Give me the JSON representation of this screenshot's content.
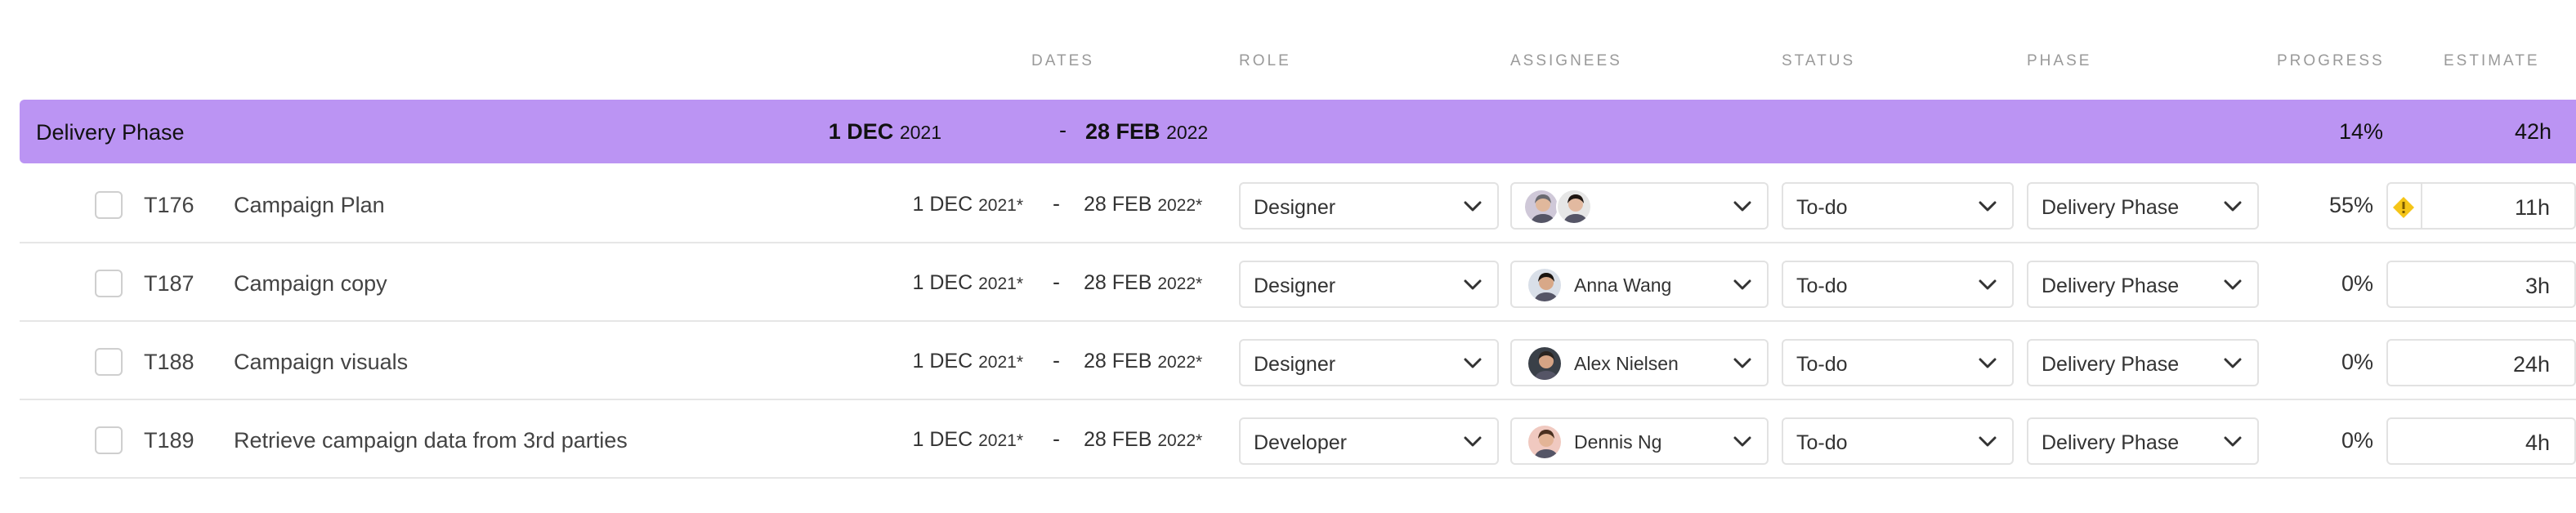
{
  "headers": {
    "dates": "DATES",
    "role": "ROLE",
    "assignees": "ASSIGNEES",
    "status": "STATUS",
    "phase": "PHASE",
    "progress": "PROGRESS",
    "estimate": "ESTIMATE"
  },
  "group": {
    "name": "Delivery Phase",
    "start_day": "1 DEC",
    "start_year": "2021",
    "dash": "-",
    "end_day": "28 FEB",
    "end_year": "2022",
    "progress": "14%",
    "estimate": "42h"
  },
  "tasks": [
    {
      "id": "T176",
      "name": "Campaign Plan",
      "start_day": "1 DEC",
      "start_year": "2021*",
      "dash": "-",
      "end_day": "28 FEB",
      "end_year": "2022*",
      "role": "Designer",
      "assignee": "",
      "status": "To-do",
      "phase": "Delivery Phase",
      "progress": "55%",
      "estimate": "11h"
    },
    {
      "id": "T187",
      "name": "Campaign copy",
      "start_day": "1 DEC",
      "start_year": "2021*",
      "dash": "-",
      "end_day": "28 FEB",
      "end_year": "2022*",
      "role": "Designer",
      "assignee": "Anna Wang",
      "status": "To-do",
      "phase": "Delivery Phase",
      "progress": "0%",
      "estimate": "3h"
    },
    {
      "id": "T188",
      "name": "Campaign visuals",
      "start_day": "1 DEC",
      "start_year": "2021*",
      "dash": "-",
      "end_day": "28 FEB",
      "end_year": "2022*",
      "role": "Designer",
      "assignee": "Alex Nielsen",
      "status": "To-do",
      "phase": "Delivery Phase",
      "progress": "0%",
      "estimate": "24h"
    },
    {
      "id": "T189",
      "name": "Retrieve campaign data from 3rd parties",
      "start_day": "1 DEC",
      "start_year": "2021*",
      "dash": "-",
      "end_day": "28 FEB",
      "end_year": "2022*",
      "role": "Developer",
      "assignee": "Dennis Ng",
      "status": "To-do",
      "phase": "Delivery Phase",
      "progress": "0%",
      "estimate": "4h"
    }
  ],
  "colors": {
    "group_bg": "#bb94f3",
    "warning": "#f5c518",
    "border": "#e2e2e2"
  },
  "icons": {
    "dropdown": "chevron-down-icon",
    "warning": "warning-diamond-icon",
    "checkbox": "checkbox-icon"
  }
}
